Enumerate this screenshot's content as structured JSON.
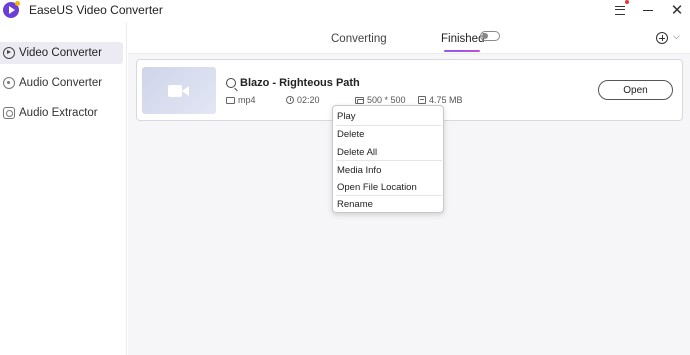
{
  "app": {
    "title": "EaseUS Video Converter"
  },
  "sidebar": {
    "items": [
      {
        "label": "Video Converter",
        "active": true,
        "icon": "video-converter-icon"
      },
      {
        "label": "Audio Converter",
        "active": false,
        "icon": "audio-converter-icon"
      },
      {
        "label": "Audio Extractor",
        "active": false,
        "icon": "audio-extractor-icon"
      }
    ]
  },
  "tabs": [
    {
      "label": "Converting",
      "active": false
    },
    {
      "label": "Finished",
      "active": true
    }
  ],
  "file": {
    "title": "Blazo - Righteous Path",
    "format": "mp4",
    "duration": "02:20",
    "resolution": "500 * 500",
    "size": "4.75 MB",
    "open_label": "Open"
  },
  "context_menu": {
    "items": [
      "Play",
      "Delete",
      "Delete All",
      "Media Info",
      "Open File Location",
      "Rename"
    ]
  },
  "colors": {
    "accent": "#6a3fd8",
    "tab_underline": "#a355e6",
    "active_bg": "#ecebf3"
  }
}
